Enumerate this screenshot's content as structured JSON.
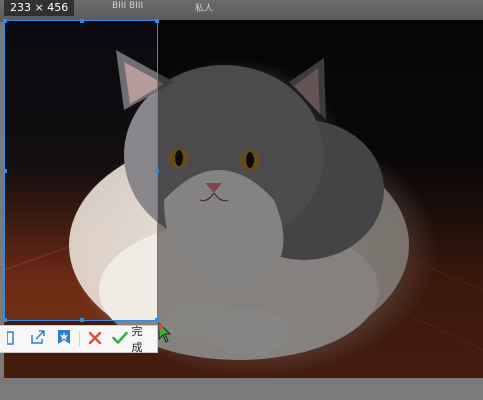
{
  "selection": {
    "size_label": "233 × 456"
  },
  "background_app": {
    "top_text_1": "BIII BIII",
    "top_text_2": "私人"
  },
  "toolbar": {
    "items": [
      {
        "name": "save-icon"
      },
      {
        "name": "share-icon"
      },
      {
        "name": "pin-icon"
      },
      {
        "name": "cancel-icon"
      }
    ],
    "done_label": "完成"
  },
  "colors": {
    "accent": "#2f8de4",
    "cancel": "#e5483a",
    "confirm": "#3cae3c",
    "pin": "#2f7fd9"
  }
}
